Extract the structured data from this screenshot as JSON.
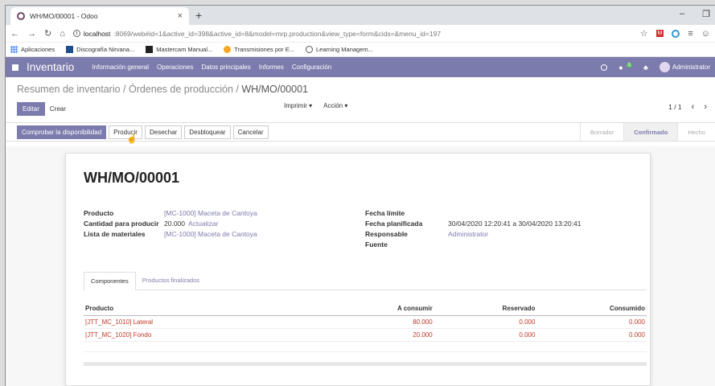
{
  "browser": {
    "tab_title": "WH/MO/00001 - Odoo",
    "tab_close": "×",
    "new_tab": "+",
    "url_host": "localhost",
    "url_path": ":8069/web#id=1&active_id=398&active_id=8&model=mrp.production&view_type=form&cids=&menu_id=197",
    "bookmarks": [
      "Aplicaciones",
      "Discografía Nirvana...",
      "Mastercam Manual...",
      "Transmisiones por E...",
      "Learning Managem..."
    ]
  },
  "navbar": {
    "brand": "Inventario",
    "menu": [
      "Información general",
      "Operaciones",
      "Datos principales",
      "Informes",
      "Configuración"
    ],
    "chat_count": "1",
    "user": "Administrator",
    "accent": "#7c7bad"
  },
  "control": {
    "breadcrumb_parent": "Resumen de inventario",
    "breadcrumb_mid": "Órdenes de producción",
    "breadcrumb_current": "WH/MO/00001",
    "sep": " / ",
    "edit_label": "Editar",
    "create_label": "Crear",
    "print_label": "Imprimir ▾",
    "action_label": "Acción ▾",
    "pager": "1 / 1"
  },
  "statusbar": {
    "buttons": [
      "Comprobar la disponibilidad",
      "Producir",
      "Desechar",
      "Desbloquear",
      "Cancelar"
    ],
    "states": [
      "Borrador",
      "Confirmado",
      "Hecho"
    ]
  },
  "form": {
    "title": "WH/MO/00001",
    "product_label": "Producto",
    "product_value": "[MC-1000] Maceta de Cantoya",
    "qty_label": "Cantidad para producir",
    "qty_value": "20.000",
    "qty_update": "Actualizar",
    "bom_label": "Lista de materiales",
    "bom_value": "[MC-1000] Maceta de Cantoya",
    "deadline_label": "Fecha límite",
    "deadline_value": "",
    "planned_label": "Fecha planificada",
    "planned_value": "30/04/2020 12:20:41 a 30/04/2020 13:20:41",
    "responsible_label": "Responsable",
    "responsible_value": "Administrator",
    "source_label": "Fuente",
    "source_value": ""
  },
  "tabs": [
    "Componentes",
    "Productos finalizados"
  ],
  "components": {
    "headers": [
      "Producto",
      "A consumir",
      "Reservado",
      "Consumido"
    ],
    "rows": [
      [
        "[JTT_MC_1010] Lateral",
        "80.000",
        "0.000",
        "0.000"
      ],
      [
        "[JTT_MC_1020] Fondo",
        "20.000",
        "0.000",
        "0.000"
      ]
    ]
  }
}
